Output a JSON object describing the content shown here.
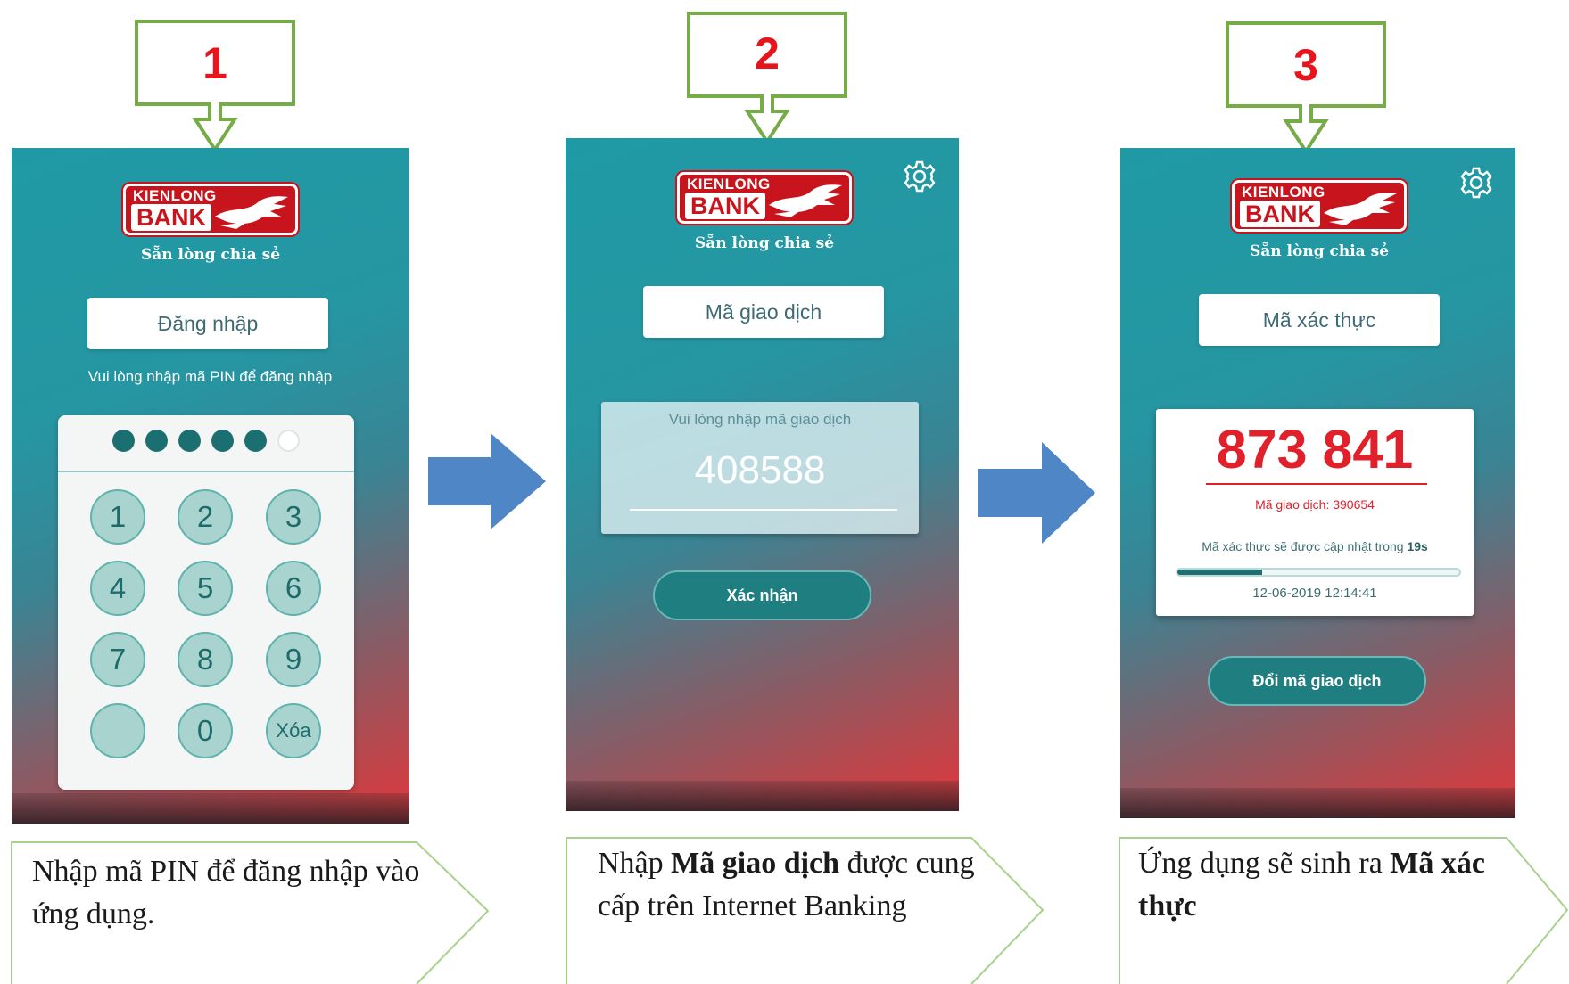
{
  "steps": [
    "1",
    "2",
    "3"
  ],
  "logo": {
    "top": "KIENLONG",
    "bank": "BANK",
    "slogan": "Sẵn lòng chia sẻ"
  },
  "screen1": {
    "title": "Đăng nhập",
    "hint": "Vui lòng nhập mã PIN để đăng nhập",
    "pin_filled": 5,
    "pin_length": 6,
    "keys": [
      "1",
      "2",
      "3",
      "4",
      "5",
      "6",
      "7",
      "8",
      "9",
      "",
      "0",
      "Xóa"
    ]
  },
  "screen2": {
    "title": "Mã giao dịch",
    "input_label": "Vui lòng nhập mã giao dịch",
    "input_value": "408588",
    "button": "Xác nhận"
  },
  "screen3": {
    "title": "Mã xác thực",
    "code": "873 841",
    "txn_label": "Mã giao dịch: 390654",
    "refresh_prefix": "Mã xác thực sẽ được cập nhật trong",
    "refresh_seconds": "19s",
    "progress": 0.3,
    "timestamp": "12-06-2019 12:14:41",
    "button": "Đổi mã giao dịch"
  },
  "captions": {
    "c1": {
      "text": "Nhập mã PIN để đăng nhập vào ứng dụng."
    },
    "c2": {
      "pre": "Nhập ",
      "bold": "Mã giao dịch",
      "post": " được cung cấp trên Internet Banking"
    },
    "c3": {
      "pre": "Ứng dụng sẽ sinh ra ",
      "bold": "Mã xác thực",
      "post": ""
    }
  },
  "colors": {
    "step_green": "#76ac46",
    "step_red": "#e8141c",
    "arrow_blue": "#4f86c6",
    "caption_border": "#a9d18e",
    "teal": "#1f9aa5",
    "accent_red": "#e0202a"
  }
}
